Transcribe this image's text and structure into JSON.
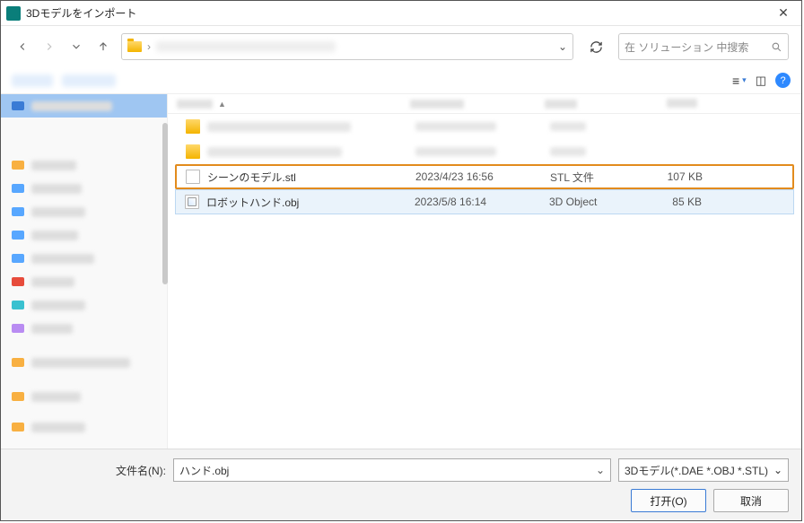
{
  "title": "3Dモデルをインポート",
  "search_placeholder": "在 ソリューション 中搜索",
  "columns": {
    "sort_indicator": "▲"
  },
  "files": [
    {
      "name": "シーンのモデル.stl",
      "date": "2023/4/23 16:56",
      "type": "STL 文件",
      "size": "107 KB",
      "selected": false,
      "highlight": true,
      "icon": "file"
    },
    {
      "name": "ロボットハンド.obj",
      "date": "2023/5/8 16:14",
      "type": "3D Object",
      "size": "85 KB",
      "selected": true,
      "highlight": false,
      "icon": "obj"
    }
  ],
  "footer": {
    "filename_label": "文件名(N):",
    "filename_value": "ハンド.obj",
    "filter_value": "3Dモデル(*.DAE *.OBJ *.STL)",
    "open_label": "打开(O)",
    "cancel_label": "取消"
  }
}
